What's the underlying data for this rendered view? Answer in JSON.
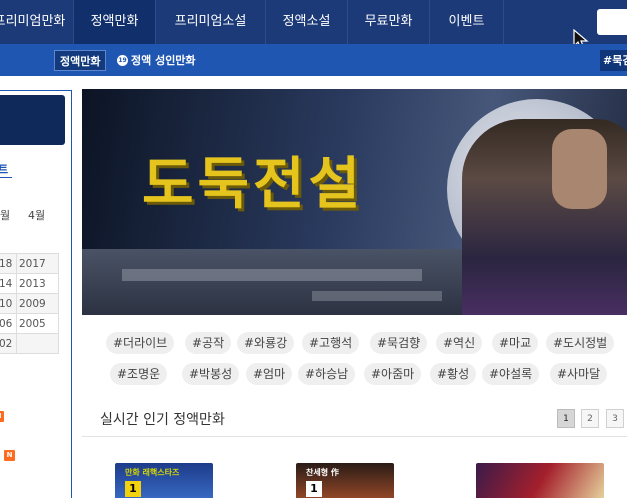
{
  "topnav": {
    "items": [
      "프리미엄만화",
      "정액만화",
      "프리미엄소설",
      "정액소설",
      "무료만화",
      "이벤트"
    ],
    "active_index": 1
  },
  "subnav": {
    "active": "정액만화",
    "adult_icon": "19",
    "adult": "정액 성인만화",
    "right_tag": "#묵검"
  },
  "sidebar": {
    "title": "트",
    "months": [
      "월",
      "4월"
    ],
    "table": [
      [
        "18",
        "2017"
      ],
      [
        "14",
        "2013"
      ],
      [
        "10",
        "2009"
      ],
      [
        "06",
        "2005"
      ],
      [
        "02",
        ""
      ]
    ],
    "badge": "N"
  },
  "banner": {
    "title": "도둑전설"
  },
  "tags": {
    "row1": [
      "#더라이브",
      "#공작",
      "#와룡강",
      "#고행석",
      "#묵검향",
      "#역신",
      "#마교",
      "#도시정벌"
    ],
    "row2": [
      "#조명운",
      "#박봉성",
      "#엄마",
      "#하승남",
      "#아줌마",
      "#황성",
      "#야설록",
      "#사마달"
    ]
  },
  "section": {
    "title": "실시간 인기 정액만화",
    "pages": [
      "1",
      "2",
      "3"
    ],
    "active_page": "1"
  },
  "thumbs": [
    {
      "caption": "만화 래핵스타즈",
      "number": "1"
    },
    {
      "caption": "찬세형 作",
      "number": "1"
    }
  ],
  "colors": {
    "nav_bg": "#1d3a78",
    "subnav_bg": "#1e56b2",
    "banner_title": "#e5c51d",
    "badge": "#ff6b1f"
  }
}
